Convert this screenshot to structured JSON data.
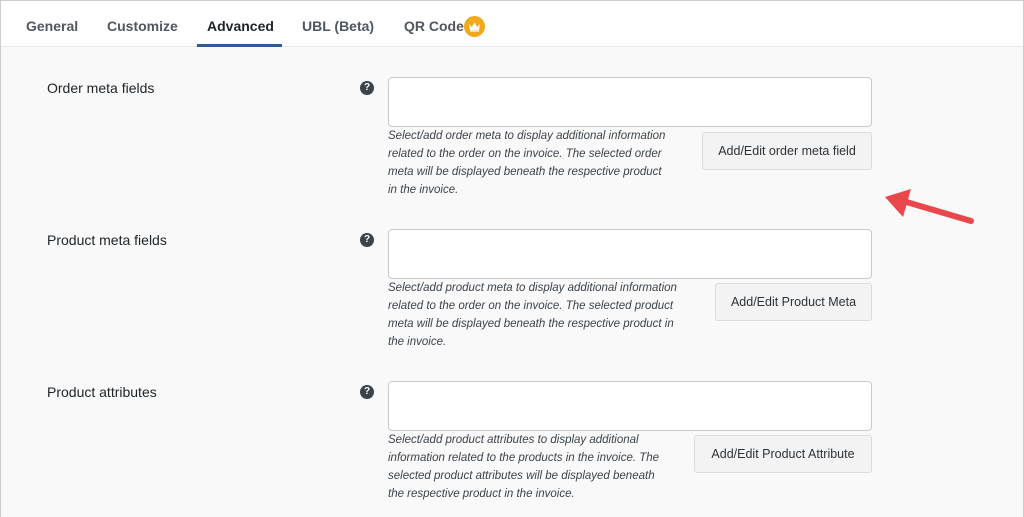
{
  "tabs": [
    {
      "label": "General"
    },
    {
      "label": "Customize"
    },
    {
      "label": "Advanced"
    },
    {
      "label": "UBL (Beta)"
    },
    {
      "label": "QR Code"
    }
  ],
  "active_tab": "Advanced",
  "sections": [
    {
      "label": "Order meta fields",
      "description": [
        "Select/add order meta to display additional information",
        "related to the order on the invoice. The selected order",
        "meta will be displayed beneath the respective product",
        "in the invoice."
      ],
      "button": "Add/Edit order meta field",
      "field_value": ""
    },
    {
      "label": "Product meta fields",
      "description": [
        "Select/add product meta to display additional information",
        "related to the order on the invoice. The selected product",
        "meta will be displayed beneath the respective product in",
        "the invoice."
      ],
      "button": "Add/Edit Product Meta",
      "field_value": ""
    },
    {
      "label": "Product attributes",
      "description": [
        "Select/add product attributes to display additional",
        "information related to the products in the invoice. The",
        "selected product attributes will be displayed beneath",
        "the respective product in the invoice."
      ],
      "button": "Add/Edit Product Attribute",
      "field_value": ""
    }
  ],
  "icons": {
    "help": "question-circle-icon",
    "premium": "crown-icon",
    "annotation": "red-arrow-icon"
  },
  "colors": {
    "accent": "#2c5aa0",
    "premium_badge": "#f0a81c",
    "arrow": "#e8484b"
  }
}
